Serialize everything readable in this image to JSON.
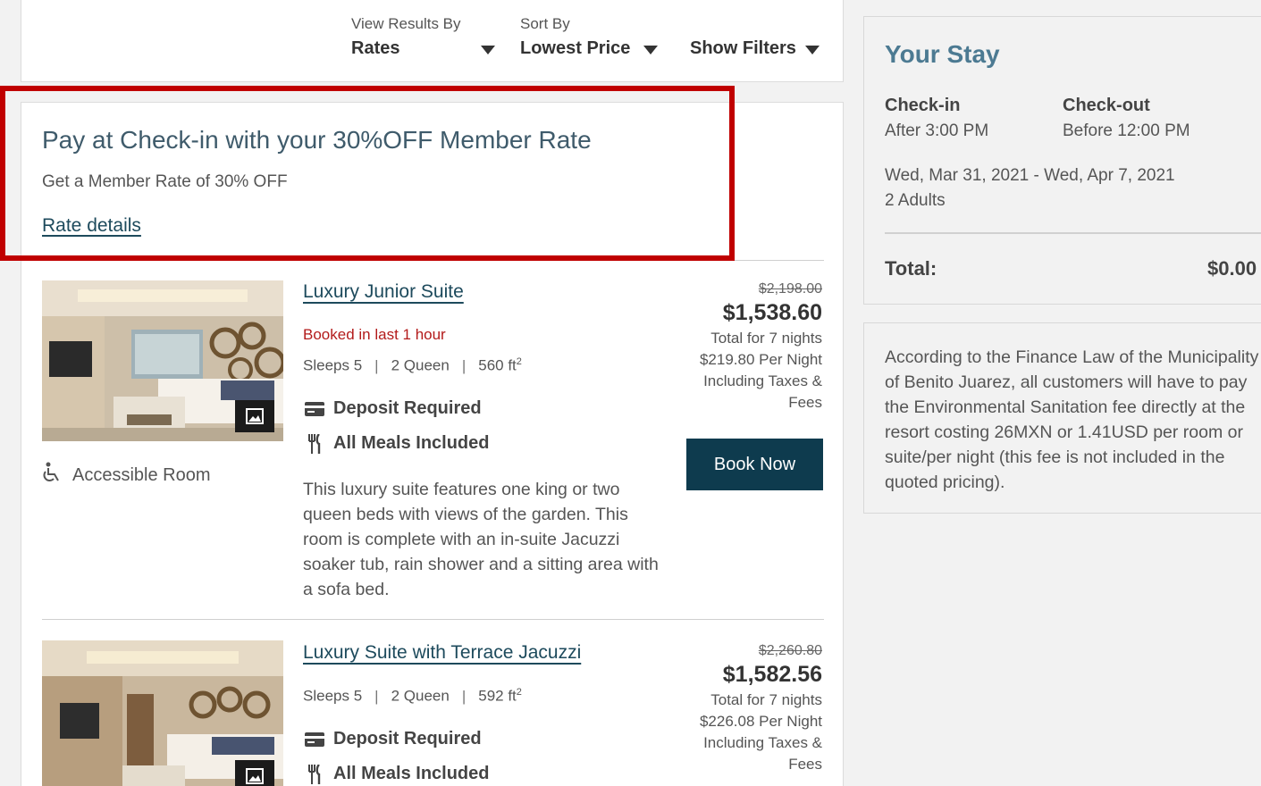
{
  "filters": {
    "view_label": "View Results By",
    "view_value": "Rates",
    "sort_label": "Sort By",
    "sort_value": "Lowest Price",
    "show_filters": "Show Filters"
  },
  "promo": {
    "title": "Pay at Check-in with your 30%OFF Member Rate",
    "subtitle": "Get a Member Rate of 30% OFF",
    "link": "Rate details"
  },
  "rooms": [
    {
      "name": "Luxury Junior Suite",
      "booked": "Booked in last 1 hour",
      "sleeps": "Sleeps 5",
      "beds": "2 Queen",
      "size": "560 ft",
      "size_sup": "2",
      "deposit": "Deposit Required",
      "meals": "All Meals Included",
      "description": "This luxury suite features one king or two queen beds with views of the garden. This room is complete with an in-suite Jacuzzi soaker tub, rain shower and a sitting area with a sofa bed.",
      "accessible": "Accessible Room",
      "old_price": "$2,198.00",
      "price": "$1,538.60",
      "total_nights": "Total for 7 nights",
      "per_night": "$219.80 Per Night",
      "taxes_1": "Including Taxes &",
      "taxes_2": "Fees",
      "book": "Book Now"
    },
    {
      "name": "Luxury Suite with Terrace Jacuzzi",
      "sleeps": "Sleeps 5",
      "beds": "2 Queen",
      "size": "592 ft",
      "size_sup": "2",
      "deposit": "Deposit Required",
      "meals": "All Meals Included",
      "old_price": "$2,260.80",
      "price": "$1,582.56",
      "total_nights": "Total for 7 nights",
      "per_night": "$226.08 Per Night",
      "taxes_1": "Including Taxes &",
      "taxes_2": "Fees"
    }
  ],
  "stay": {
    "title": "Your Stay",
    "checkin_label": "Check-in",
    "checkin_value": "After 3:00 PM",
    "checkout_label": "Check-out",
    "checkout_value": "Before 12:00 PM",
    "dates": "Wed, Mar 31, 2021 - Wed, Apr 7, 2021",
    "guests": "2 Adults",
    "total_label": "Total:",
    "total_value": "$0.00"
  },
  "tax_notice": "According to the Finance Law of the Municipality of Benito Juarez, all customers will have to pay the Environmental Sanitation fee directly at the resort costing 26MXN or 1.41USD per room or suite/per night (this fee is not included in the quoted pricing).",
  "colors": {
    "highlight": "#c00000",
    "link": "#1d4a5c",
    "button": "#0e3b4e",
    "booked_alert": "#b31b1b"
  }
}
